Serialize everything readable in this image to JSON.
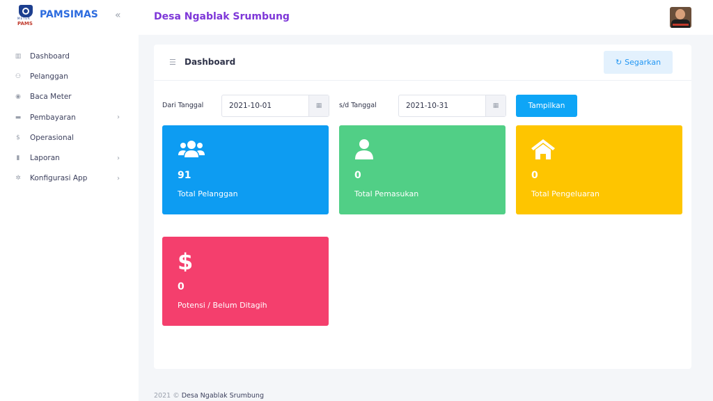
{
  "app": {
    "brand": "PAMSIMAS",
    "logo_text": "PAMS",
    "logo_sub": "METER",
    "collapse_icon": "«"
  },
  "sidebar": {
    "items": [
      {
        "label": "Dashboard",
        "icon": "chart-icon",
        "glyph": "▥",
        "has_children": false
      },
      {
        "label": "Pelanggan",
        "icon": "users-icon",
        "glyph": "⚇",
        "has_children": false
      },
      {
        "label": "Baca Meter",
        "icon": "gauge-icon",
        "glyph": "◉",
        "has_children": false
      },
      {
        "label": "Pembayaran",
        "icon": "credit-card-icon",
        "glyph": "▬",
        "has_children": true
      },
      {
        "label": "Operasional",
        "icon": "dollar-icon",
        "glyph": "$",
        "has_children": false
      },
      {
        "label": "Laporan",
        "icon": "file-icon",
        "glyph": "▮",
        "has_children": true
      },
      {
        "label": "Konfigurasi App",
        "icon": "gear-icon",
        "glyph": "✲",
        "has_children": true
      }
    ],
    "chevron": "›"
  },
  "header": {
    "title": "Desa Ngablak Srumbung"
  },
  "card": {
    "title": "Dashboard",
    "title_icon": "☰",
    "refresh_label": "Segarkan",
    "refresh_icon": "↻"
  },
  "filter": {
    "from_label": "Dari Tanggal",
    "from_value": "2021-10-01",
    "to_label": "s/d Tanggal",
    "to_value": "2021-10-31",
    "calendar_icon": "▦",
    "submit_label": "Tampilkan"
  },
  "stats": [
    {
      "value": "91",
      "label": "Total Pelanggan",
      "color": "#0d9cf2",
      "icon": "users-icon"
    },
    {
      "value": "0",
      "label": "Total Pemasukan",
      "color": "#51cf86",
      "icon": "user-icon"
    },
    {
      "value": "0",
      "label": "Total Pengeluaran",
      "color": "#fec500",
      "icon": "home-icon"
    },
    {
      "value": "0",
      "label": "Potensi / Belum Ditagih",
      "color": "#f43f6d",
      "icon": "dollar-icon"
    }
  ],
  "footer": {
    "year": "2021 ©",
    "name": "Desa Ngablak Srumbung"
  }
}
